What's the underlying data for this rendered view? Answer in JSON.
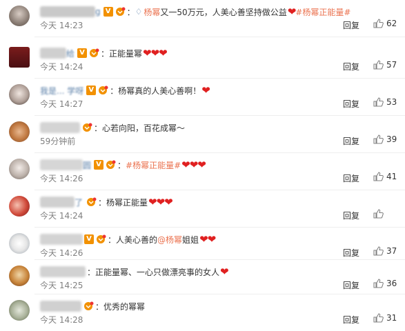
{
  "ui": {
    "reply_label": "回复",
    "colors": {
      "link": "#eb7350",
      "time": "#808080",
      "heart": "#e02020",
      "badge": "#f29100"
    }
  },
  "comments": [
    {
      "username_visible": "g",
      "has_v": true,
      "has_fan": true,
      "prefix": "：",
      "link": "杨幂",
      "text": " 又一50万元，人美心善坚持做公益",
      "hearts": "❤",
      "topic": "#杨幂正能量#",
      "time": "今天 14:23",
      "likes": "62"
    },
    {
      "username_visible": "给",
      "has_v": true,
      "has_fan": true,
      "prefix": "：",
      "text": "正能量幂",
      "hearts": "❤❤❤",
      "time": "今天 14:24",
      "likes": "57"
    },
    {
      "username_visible": "我是... 学呀",
      "has_v": true,
      "has_fan": true,
      "prefix": "：",
      "text": "杨幂真的人美心善啊！",
      "hearts": "❤",
      "time": "今天 14:27",
      "likes": "53"
    },
    {
      "username_visible": "",
      "has_v": false,
      "has_fan": true,
      "prefix": "：",
      "text": "心若向阳，百花成幂～",
      "hearts": "",
      "time": "59分钟前",
      "likes": "39"
    },
    {
      "username_visible": "圆",
      "has_v": true,
      "has_fan": true,
      "prefix": "：",
      "topic": "#杨幂正能量#",
      "text": "",
      "hearts": "❤❤❤",
      "time": "今天 14:26",
      "likes": "41"
    },
    {
      "username_visible": "了",
      "has_v": false,
      "has_fan": true,
      "prefix": "：",
      "text": "杨幂正能量",
      "hearts": "❤❤❤",
      "time": "今天 14:24",
      "likes": ""
    },
    {
      "username_visible": "",
      "has_v": true,
      "has_fan": true,
      "prefix": "：",
      "text": "人美心善的",
      "link": "@杨幂",
      "text2": " 姐姐",
      "hearts": "❤❤",
      "time": "今天 14:26",
      "likes": "37"
    },
    {
      "username_visible": "",
      "has_v": false,
      "has_fan": false,
      "prefix": "：",
      "text": "正能量幂、一心只做漂亮事的女人",
      "hearts": "❤",
      "time": "今天 14:25",
      "likes": "36"
    },
    {
      "username_visible": "",
      "has_v": false,
      "has_fan": true,
      "prefix": "：",
      "text": "优秀的幂幂",
      "hearts": "",
      "time": "今天 14:28",
      "likes": "31"
    }
  ]
}
